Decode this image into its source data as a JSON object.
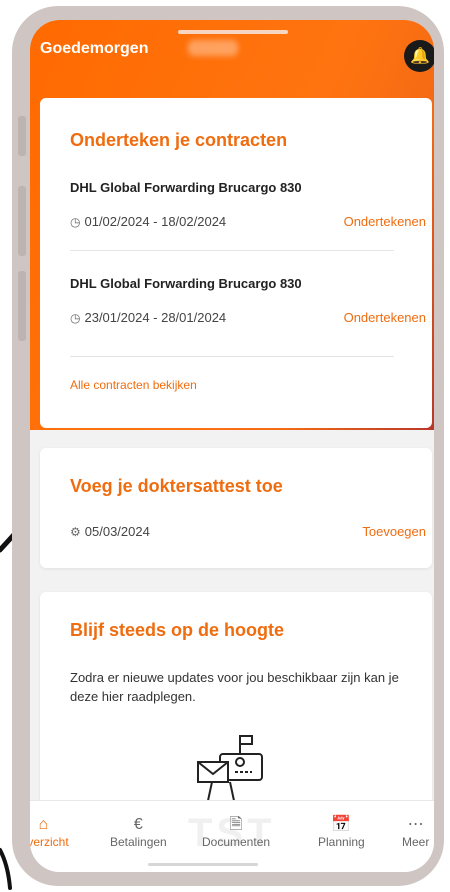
{
  "header": {
    "greeting": "Goedemorgen"
  },
  "contracts_card": {
    "title": "Onderteken je contracten",
    "contracts": [
      {
        "name": "DHL Global Forwarding Brucargo 830",
        "dates": "01/02/2024 - 18/02/2024",
        "action": "Ondertekenen"
      },
      {
        "name": "DHL Global Forwarding Brucargo 830",
        "dates": "23/01/2024 - 28/01/2024",
        "action": "Ondertekenen"
      }
    ],
    "view_all": "Alle contracten bekijken"
  },
  "certificate_card": {
    "title": "Voeg je doktersattest toe",
    "date": "05/03/2024",
    "action": "Toevoegen"
  },
  "updates_card": {
    "title": "Blijf steeds op de hoogte",
    "description": "Zodra er nieuwe updates voor jou beschikbaar zijn kan je deze hier raadplegen."
  },
  "watermark": "TST",
  "bottom_nav": [
    {
      "label": "Overzicht",
      "icon": "home-icon",
      "active": true
    },
    {
      "label": "Betalingen",
      "icon": "euro-icon",
      "active": false
    },
    {
      "label": "Documenten",
      "icon": "document-icon",
      "active": false
    },
    {
      "label": "Planning",
      "icon": "calendar-icon",
      "active": false
    },
    {
      "label": "Meer",
      "icon": "more-icon",
      "active": false
    }
  ],
  "colors": {
    "accent": "#ef6c0f",
    "header_start": "#ff6a00",
    "header_end": "#b8372a"
  }
}
